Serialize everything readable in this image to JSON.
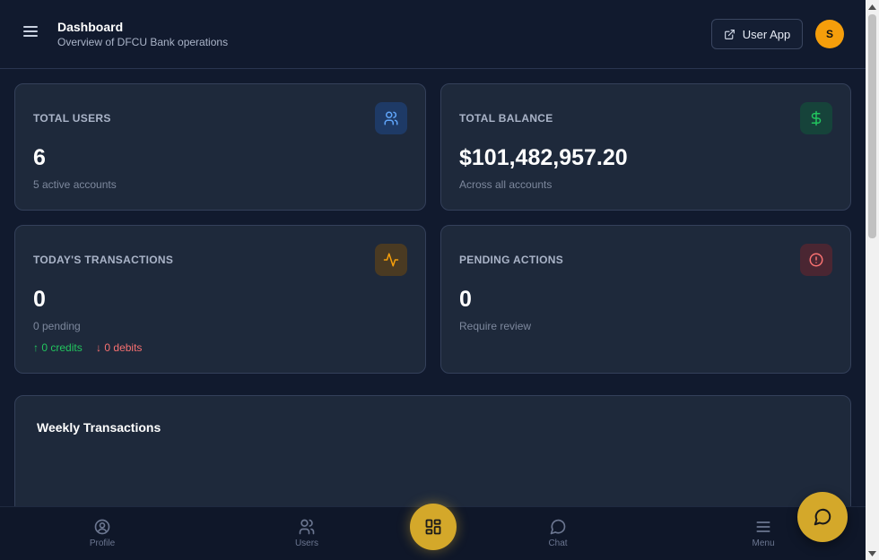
{
  "header": {
    "title": "Dashboard",
    "subtitle": "Overview of DFCU Bank operations",
    "user_app_label": "User App",
    "avatar_initial": "S"
  },
  "stats": [
    {
      "label": "TOTAL USERS",
      "value": "6",
      "sub": "5 active accounts",
      "icon": "users-icon",
      "icon_color": "#60a5fa",
      "icon_bg": "#1e3a66"
    },
    {
      "label": "TOTAL BALANCE",
      "value": "$101,482,957.20",
      "sub": "Across all accounts",
      "icon": "dollar-icon",
      "icon_color": "#22c55e",
      "icon_bg": "#16433a"
    },
    {
      "label": "TODAY'S TRANSACTIONS",
      "value": "0",
      "sub": "0 pending",
      "icon": "activity-icon",
      "icon_color": "#f59e0b",
      "icon_bg": "#4a3a22"
    },
    {
      "label": "PENDING ACTIONS",
      "value": "0",
      "sub": "Require review",
      "icon": "alert-circle-icon",
      "icon_color": "#f87171",
      "icon_bg": "#4a2632"
    }
  ],
  "transactions_breakdown": {
    "credits": "0 credits",
    "debits": "0 debits"
  },
  "weekly": {
    "title": "Weekly Transactions"
  },
  "bottom_nav": {
    "items": [
      {
        "label": "Profile",
        "icon": "user-circle-icon"
      },
      {
        "label": "Users",
        "icon": "users-icon"
      },
      {
        "label": "Chat",
        "icon": "chat-bubble-icon"
      },
      {
        "label": "Menu",
        "icon": "hamburger-icon"
      }
    ],
    "center_icon": "grid-icon"
  },
  "colors": {
    "background": "#111a2e",
    "card": "#1e293b",
    "accent_gold": "#d4a82a",
    "avatar": "#f59e0b"
  }
}
